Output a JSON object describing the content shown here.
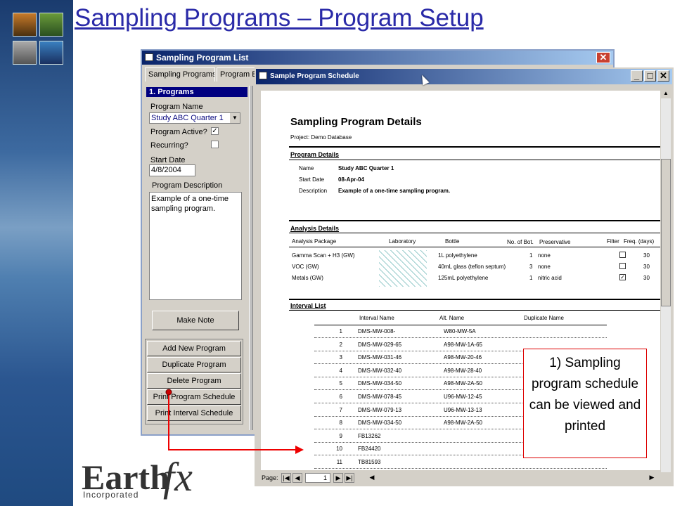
{
  "slide": {
    "title": "Sampling Programs – Program Setup"
  },
  "list_window": {
    "title": "Sampling Program List",
    "tabs": [
      "Sampling Programs",
      "Program Es"
    ],
    "section_header": "1. Programs",
    "program_name_label": "Program Name",
    "program_name_value": "Study ABC Quarter 1",
    "program_active_label": "Program Active?",
    "program_active_checked": "✓",
    "recurring_label": "Recurring?",
    "start_date_label": "Start Date",
    "start_date_value": "4/8/2004",
    "description_label": "Program Description",
    "description_value": "Example of a one-time sampling program.",
    "make_note": "Make Note",
    "buttons": [
      "Add New Program",
      "Duplicate Program",
      "Delete Program",
      "Print Program Schedule",
      "Print Interval Schedule"
    ]
  },
  "schedule_window": {
    "title": "Sample Program Schedule",
    "report": {
      "heading": "Sampling Program Details",
      "project": "Project: Demo Database",
      "program_details_title": "Program Details",
      "details": [
        {
          "label": "Name",
          "value": "Study ABC Quarter 1"
        },
        {
          "label": "Start Date",
          "value": "08-Apr-04"
        },
        {
          "label": "Description",
          "value": "Example of a one-time sampling program."
        }
      ],
      "analysis_details_title": "Analysis Details",
      "analysis_headers": [
        "Analysis Package",
        "Laboratory",
        "Bottle",
        "No. of Bot.",
        "Preservative",
        "Filter",
        "Freq. (days)"
      ],
      "analysis_rows": [
        {
          "package": "Gamma Scan + H3 (GW)",
          "bottle": "1L polyethylene",
          "count": "1",
          "preservative": "none",
          "filter": "",
          "freq": "30"
        },
        {
          "package": "VOC (GW)",
          "bottle": "40mL glass (teflon septum)",
          "count": "3",
          "preservative": "none",
          "filter": "",
          "freq": "30"
        },
        {
          "package": "Metals (GW)",
          "bottle": "125mL polyethylene",
          "count": "1",
          "preservative": "nitric acid",
          "filter": "✓",
          "freq": "30"
        }
      ],
      "interval_list_title": "Interval List",
      "interval_headers": [
        "Interval Name",
        "Alt. Name",
        "Duplicate Name"
      ],
      "interval_rows": [
        {
          "n": "1",
          "name": "DMS-MW-008-",
          "alt": "W80-MW-5A"
        },
        {
          "n": "2",
          "name": "DMS-MW-029-65",
          "alt": "A98-MW-1A-65"
        },
        {
          "n": "3",
          "name": "DMS-MW-031-46",
          "alt": "A98-MW-20-46"
        },
        {
          "n": "4",
          "name": "DMS-MW-032-40",
          "alt": "A98-MW-28-40"
        },
        {
          "n": "5",
          "name": "DMS-MW-034-50",
          "alt": "A98-MW-2A-50"
        },
        {
          "n": "6",
          "name": "DMS-MW-078-45",
          "alt": "U96-MW-12-45"
        },
        {
          "n": "7",
          "name": "DMS-MW-079-13",
          "alt": "U96-MW-13-13"
        },
        {
          "n": "8",
          "name": "DMS-MW-034-50",
          "alt": "A98-MW-2A-50"
        },
        {
          "n": "9",
          "name": "FB13262",
          "alt": ""
        },
        {
          "n": "10",
          "name": "FB24420",
          "alt": ""
        },
        {
          "n": "11",
          "name": "TB81593",
          "alt": ""
        }
      ]
    },
    "page_label": "Page:",
    "page_value": "1"
  },
  "callout": {
    "text": "1) Sampling program schedule can be viewed and printed"
  },
  "logo": {
    "text": "Earth",
    "fx": "fx",
    "incorporated": "Incorporated"
  },
  "colors": {
    "title": "#2a2aa8",
    "titlebar": "#0a246a",
    "callout_border": "#dd0000",
    "arrow": "#ee0000"
  }
}
